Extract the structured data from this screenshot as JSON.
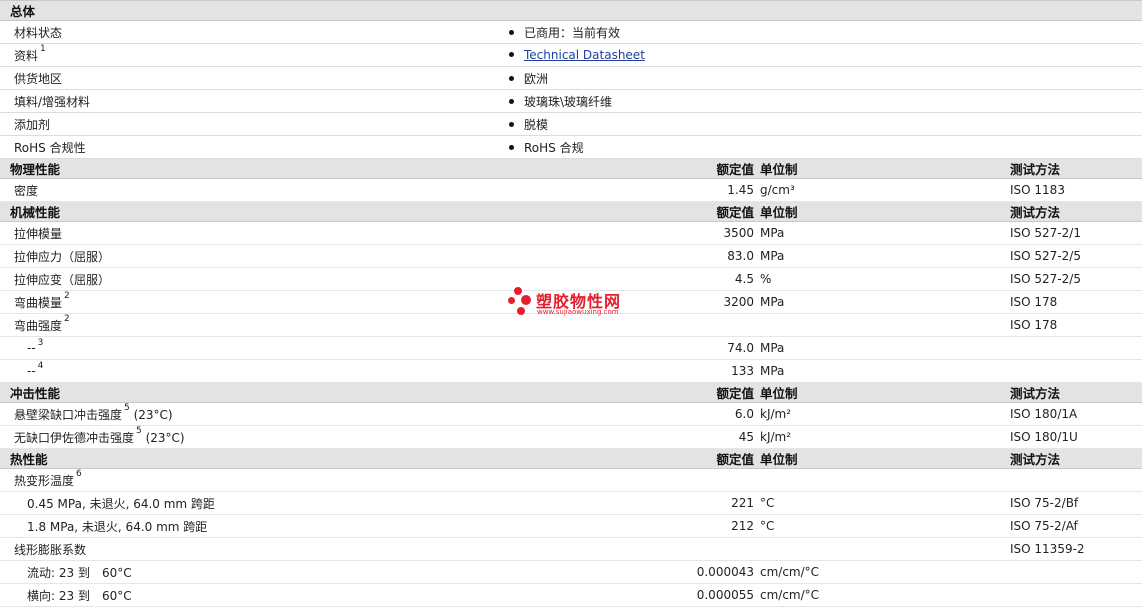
{
  "general": {
    "header": "总体",
    "rows": [
      {
        "label": "材料状态",
        "value": "已商用：当前有效",
        "sup": ""
      },
      {
        "label": "资料",
        "value": "Technical Datasheet",
        "sup": "1"
      },
      {
        "label": "供货地区",
        "value": "欧洲",
        "sup": ""
      },
      {
        "label": "填料/增强材料",
        "value": "玻璃珠\\玻璃纤维",
        "sup": ""
      },
      {
        "label": "添加剂",
        "value": "脱模",
        "sup": ""
      },
      {
        "label": "RoHS 合规性",
        "value": "RoHS 合规",
        "sup": ""
      }
    ]
  },
  "columns": {
    "value": "额定值",
    "unit": "单位制",
    "method": "测试方法"
  },
  "physical": {
    "header": "物理性能",
    "rows": [
      {
        "label": "密度",
        "value": "1.45",
        "unit": "g/cm³",
        "method": "ISO 1183"
      }
    ]
  },
  "mechanical": {
    "header": "机械性能",
    "rows": [
      {
        "label": "拉伸模量",
        "sup": "",
        "value": "3500",
        "unit": "MPa",
        "method": "ISO 527-2/1"
      },
      {
        "label": "拉伸应力（屈服）",
        "sup": "",
        "value": "83.0",
        "unit": "MPa",
        "method": "ISO 527-2/5"
      },
      {
        "label": "拉伸应变（屈服）",
        "sup": "",
        "value": "4.5",
        "unit": "%",
        "method": "ISO 527-2/5"
      },
      {
        "label": "弯曲模量",
        "sup": "2",
        "value": "3200",
        "unit": "MPa",
        "method": "ISO 178"
      },
      {
        "label": "弯曲强度",
        "sup": "2",
        "value": "",
        "unit": "",
        "method": "ISO 178"
      },
      {
        "label": "--",
        "sup": "3",
        "value": "74.0",
        "unit": "MPa",
        "method": ""
      },
      {
        "label": "--",
        "sup": "4",
        "value": "133",
        "unit": "MPa",
        "method": ""
      }
    ]
  },
  "impact": {
    "header": "冲击性能",
    "rows": [
      {
        "label": "悬壁梁缺口冲击强度",
        "sup": "5",
        "suffix": " (23°C)",
        "value": "6.0",
        "unit": "kJ/m²",
        "method": "ISO 180/1A"
      },
      {
        "label": "无缺口伊佐德冲击强度",
        "sup": "5",
        "suffix": " (23°C)",
        "value": "45",
        "unit": "kJ/m²",
        "method": "ISO 180/1U"
      }
    ]
  },
  "thermal": {
    "header": "热性能",
    "rows": [
      {
        "label": "热变形温度",
        "sup": "6",
        "value": "",
        "unit": "",
        "method": ""
      },
      {
        "label": "0.45 MPa, 未退火, 64.0 mm 跨距",
        "sup": "",
        "value": "221",
        "unit": "°C",
        "method": "ISO 75-2/Bf"
      },
      {
        "label": "1.8 MPa, 未退火, 64.0 mm 跨距",
        "sup": "",
        "value": "212",
        "unit": "°C",
        "method": "ISO 75-2/Af"
      },
      {
        "label": "线形膨胀系数",
        "sup": "",
        "value": "",
        "unit": "",
        "method": "ISO 11359-2"
      },
      {
        "label": "流动: 23 到　60°C",
        "sup": "",
        "value": "0.000043",
        "unit": "cm/cm/°C",
        "method": ""
      },
      {
        "label": "横向: 23 到　60°C",
        "sup": "",
        "value": "0.000055",
        "unit": "cm/cm/°C",
        "method": ""
      }
    ]
  },
  "watermark": {
    "title": "塑胶物性网",
    "url": "www.sujiaowuxing.com",
    "color": "#e61d2c"
  }
}
